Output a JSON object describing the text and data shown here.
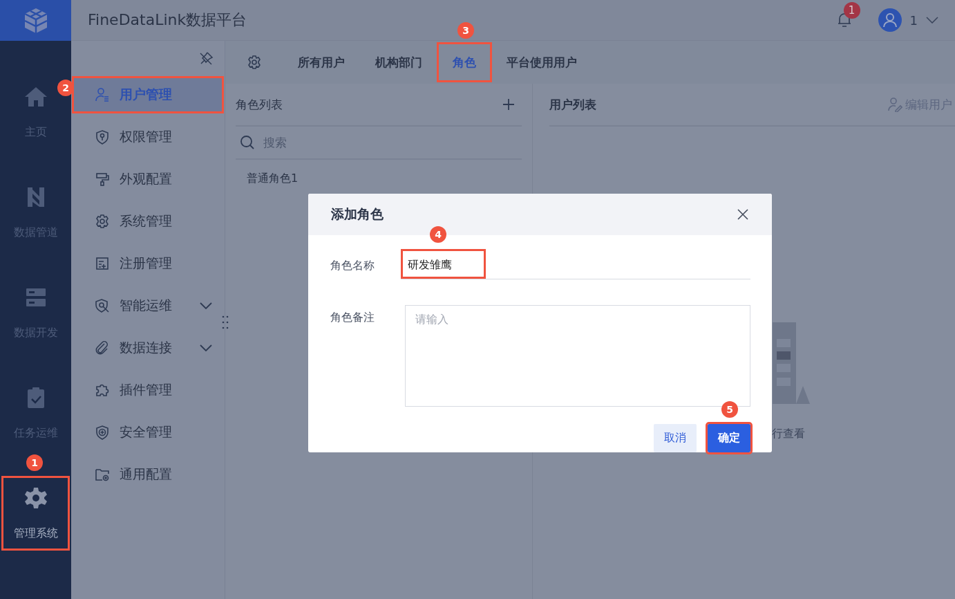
{
  "header": {
    "title": "FineDataLink数据平台",
    "notification_count": "1",
    "user_name": "1"
  },
  "rail": [
    {
      "label": "主页",
      "kind": "home",
      "selected": false,
      "highlighted": false
    },
    {
      "label": "数据管道",
      "kind": "pipeline",
      "selected": false,
      "highlighted": false
    },
    {
      "label": "数据开发",
      "kind": "dev",
      "selected": false,
      "highlighted": false
    },
    {
      "label": "任务运维",
      "kind": "task",
      "selected": false,
      "highlighted": false
    },
    {
      "label": "管理系统",
      "kind": "settings",
      "selected": true,
      "highlighted": true,
      "marker": "1"
    }
  ],
  "sidebar": {
    "items": [
      {
        "label": "用户管理",
        "kind": "user",
        "selected": true,
        "highlighted": true,
        "marker": "2",
        "expandable": false
      },
      {
        "label": "权限管理",
        "kind": "shield-key",
        "selected": false,
        "highlighted": false,
        "expandable": false
      },
      {
        "label": "外观配置",
        "kind": "paint",
        "selected": false,
        "highlighted": false,
        "expandable": false
      },
      {
        "label": "系统管理",
        "kind": "gear",
        "selected": false,
        "highlighted": false,
        "expandable": false
      },
      {
        "label": "注册管理",
        "kind": "register",
        "selected": false,
        "highlighted": false,
        "expandable": false
      },
      {
        "label": "智能运维",
        "kind": "monitor",
        "selected": false,
        "highlighted": false,
        "expandable": true
      },
      {
        "label": "数据连接",
        "kind": "link",
        "selected": false,
        "highlighted": false,
        "expandable": true
      },
      {
        "label": "插件管理",
        "kind": "puzzle",
        "selected": false,
        "highlighted": false,
        "expandable": false
      },
      {
        "label": "安全管理",
        "kind": "shield-plus",
        "selected": false,
        "highlighted": false,
        "expandable": false
      },
      {
        "label": "通用配置",
        "kind": "folder-gear",
        "selected": false,
        "highlighted": false,
        "expandable": false
      }
    ]
  },
  "tabs": [
    {
      "label": "所有用户",
      "selected": false,
      "highlighted": false
    },
    {
      "label": "机构部门",
      "selected": false,
      "highlighted": false
    },
    {
      "label": "角色",
      "selected": true,
      "highlighted": true,
      "marker": "3"
    },
    {
      "label": "平台使用用户",
      "selected": false,
      "highlighted": false
    }
  ],
  "role_panel": {
    "title": "角色列表",
    "search_placeholder": "搜索",
    "roles": [
      "普通角色1"
    ]
  },
  "user_panel": {
    "title": "用户列表",
    "edit_button": {
      "label": "编辑用户",
      "disabled": true
    },
    "empty_hint": "行查看"
  },
  "dialog": {
    "title": "添加角色",
    "fields": [
      {
        "label": "角色名称",
        "kind": "input",
        "value": "研发雏鹰",
        "highlighted": true,
        "marker": "4"
      },
      {
        "label": "角色备注",
        "kind": "textarea",
        "placeholder": "请输入",
        "highlighted": false
      }
    ],
    "buttons": [
      {
        "label": "取消",
        "kind": "secondary",
        "highlighted": false
      },
      {
        "label": "确定",
        "kind": "primary",
        "highlighted": true,
        "marker": "5"
      }
    ]
  }
}
